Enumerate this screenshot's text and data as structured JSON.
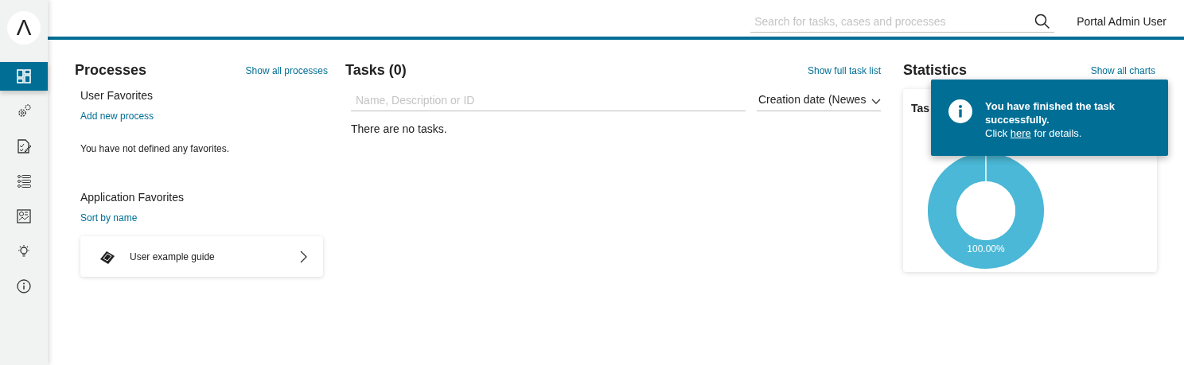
{
  "logo": {
    "glyph": "Λ"
  },
  "nav": [
    {
      "selected": true
    },
    {
      "selected": false
    },
    {
      "selected": false
    },
    {
      "selected": false
    },
    {
      "selected": false
    },
    {
      "selected": false
    },
    {
      "selected": false
    }
  ],
  "header": {
    "search": {
      "placeholder": "Search for tasks, cases and processes"
    },
    "user": "Portal Admin User"
  },
  "processes": {
    "title": "Processes",
    "link": "Show all processes",
    "user_favorites": {
      "title": "User Favorites",
      "link": "Add new process",
      "empty": "You have not defined any favorites."
    },
    "application_favorites": {
      "title": "Application Favorites",
      "link": "Sort by name",
      "items": [
        {
          "label": "User example guide"
        }
      ]
    }
  },
  "tasks": {
    "title": "Tasks (0)",
    "link": "Show full task list",
    "filter": {
      "placeholder": "Name, Description or ID"
    },
    "sort": "Creation date (Newes",
    "empty": "There are no tasks."
  },
  "statistics": {
    "title": "Statistics",
    "link": "Show all charts",
    "card": {
      "title": "Tas",
      "chart_data": {
        "type": "donut",
        "series": [
          {
            "color": "#4ab8d6",
            "values": [
              100
            ]
          }
        ],
        "value_labels": [
          "100.00%"
        ]
      }
    }
  },
  "toast": {
    "title": "You have finished the task successfully.",
    "message_start": "Click",
    "link": "here",
    "message_end": "for details."
  }
}
